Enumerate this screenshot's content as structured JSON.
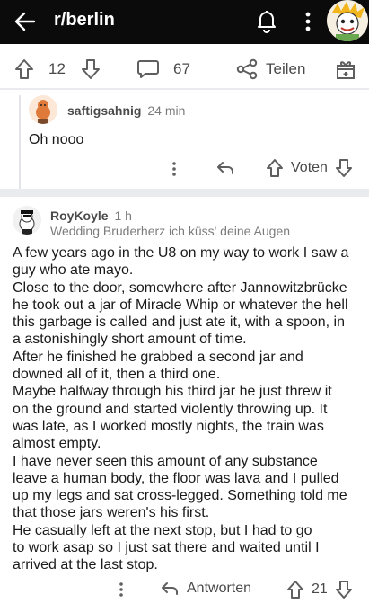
{
  "appbar": {
    "subreddit": "r/berlin"
  },
  "post_actions": {
    "score": "12",
    "comments": "67",
    "share_label": "Teilen"
  },
  "comment1": {
    "author": "saftigsahnig",
    "age": "24 min",
    "body": "Oh nooo",
    "vote_label": "Voten"
  },
  "comment2": {
    "author": "RoyKoyle",
    "age": "1 h",
    "flair": "Wedding Bruderherz ich küss' deine Augen",
    "lines": [
      "A few years ago in the U8 on my way to work I saw a",
      "guy who ate mayo.",
      "Close to the door, somewhere after Jannowitzbrücke",
      "he took out a jar of Miracle Whip or whatever the hell",
      "this garbage is called and just ate it, with a spoon, in",
      "a astonishingly short amount of time.",
      "After he finished he grabbed a second jar and",
      "downed all of it, then a third one.",
      "Maybe halfway through his third jar he just threw it",
      "on the ground and started violently throwing up. It",
      "was late, as I worked mostly nights, the train was",
      "almost empty.",
      "I have never seen this amount of any substance",
      "leave a human body, the floor was lava and I pulled",
      "up my legs and sat cross-legged. Something told me",
      "that those jars weren's his first.",
      "He casually left at the next stop, but I had to go",
      "to work asap so I just sat there and waited until I",
      "arrived at the last stop."
    ],
    "reply_label": "Antworten",
    "score": "21"
  },
  "colors": {
    "appbar": "#0b0b0b",
    "band": "#e9ebee",
    "icon": "#5f5f5f"
  }
}
